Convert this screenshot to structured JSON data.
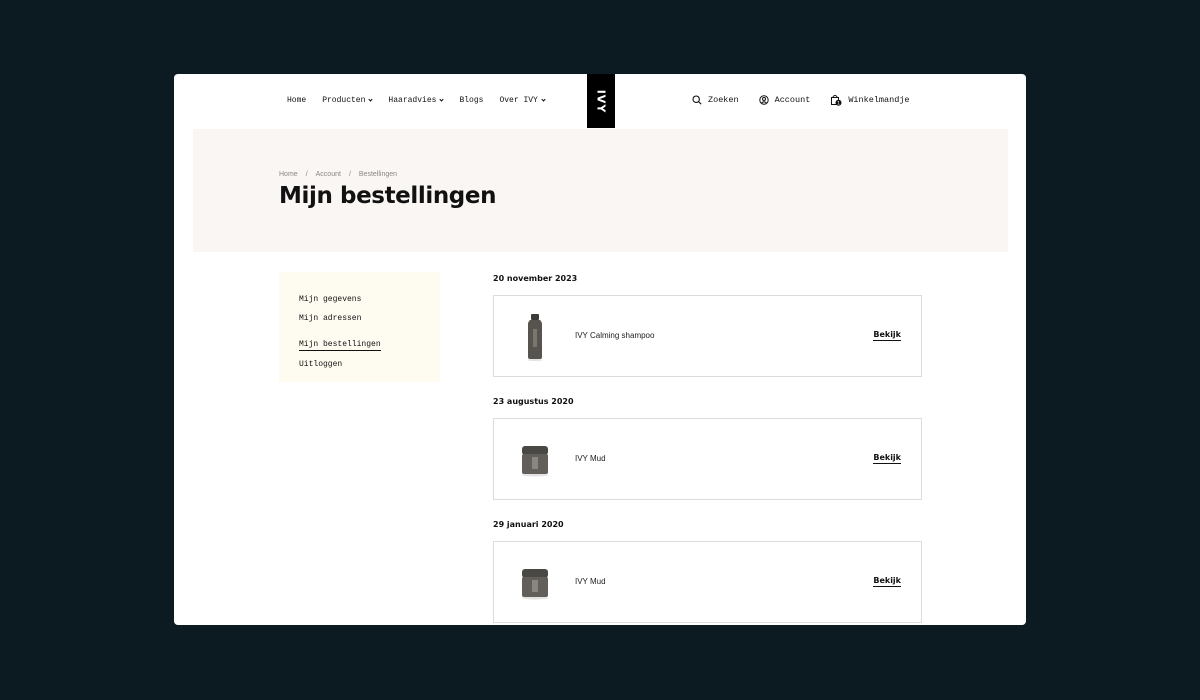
{
  "nav": {
    "items": [
      {
        "label": "Home"
      },
      {
        "label": "Producten"
      },
      {
        "label": "Haaradvies"
      },
      {
        "label": "Blogs"
      },
      {
        "label": "Over IVY"
      }
    ]
  },
  "logo": {
    "text": "IVY"
  },
  "utilities": {
    "search": "Zoeken",
    "account": "Account",
    "cart": "Winkelmandje",
    "cart_count": "1"
  },
  "breadcrumb": {
    "items": [
      "Home",
      "/",
      "Account",
      "/",
      "Bestellingen"
    ]
  },
  "page_title": "Mijn bestellingen",
  "sidebar": {
    "items": [
      {
        "label": "Mijn gegevens"
      },
      {
        "label": "Mijn adressen"
      },
      {
        "label": "Mijn bestellingen"
      },
      {
        "label": "Uitloggen"
      }
    ]
  },
  "orders": [
    {
      "date": "20 november 2023",
      "product": "IVY Calming shampoo",
      "image": "shampoo-bottle",
      "action": "Bekijk"
    },
    {
      "date": "23 augustus 2020",
      "product": "IVY Mud",
      "image": "mud-jar",
      "action": "Bekijk"
    },
    {
      "date": "29 januari 2020",
      "product": "IVY Mud",
      "image": "mud-jar",
      "action": "Bekijk"
    }
  ]
}
